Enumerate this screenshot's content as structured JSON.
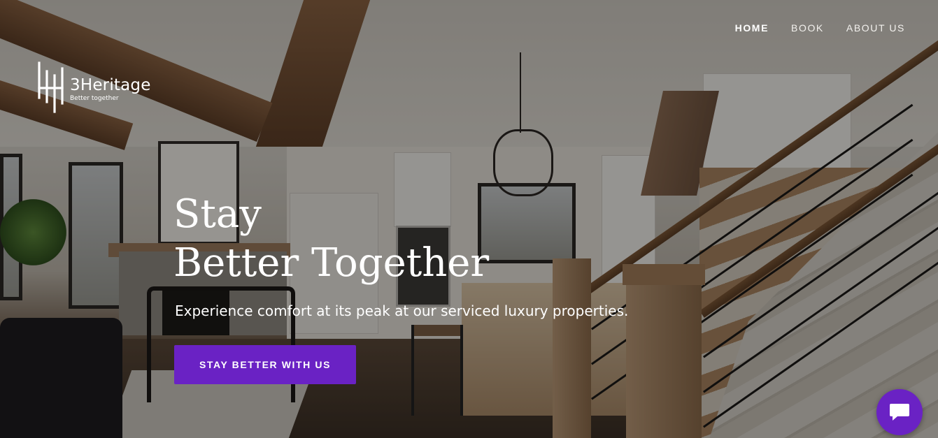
{
  "nav": {
    "items": [
      {
        "label": "HOME",
        "active": true
      },
      {
        "label": "BOOK",
        "active": false
      },
      {
        "label": "ABOUT US",
        "active": false
      }
    ]
  },
  "brand": {
    "name": "3Heritage",
    "tagline": "Better together"
  },
  "hero": {
    "headline_line1": "Stay",
    "headline_line2": "Better Together",
    "subtitle": "Experience comfort at its peak at our serviced luxury properties.",
    "cta_label": "STAY BETTER WITH US"
  },
  "chat": {
    "icon": "chat-bubble-icon"
  },
  "colors": {
    "accent": "#6a22c4",
    "text": "#ffffff"
  }
}
